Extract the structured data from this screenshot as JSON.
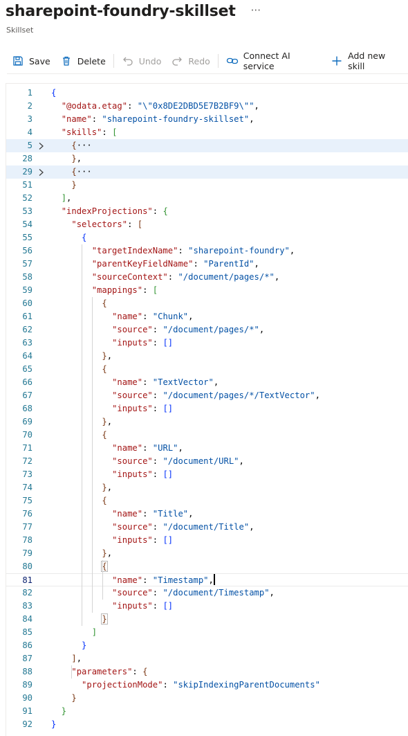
{
  "header": {
    "title": "sharepoint-foundry-skillset",
    "subtitle": "Skillset",
    "more": "···"
  },
  "toolbar": {
    "save": "Save",
    "delete": "Delete",
    "undo": "Undo",
    "redo": "Redo",
    "connect": "Connect AI service",
    "add_skill": "Add new skill"
  },
  "editor": {
    "lines": [
      {
        "n": "1",
        "t": [
          [
            "{",
            "b1"
          ]
        ]
      },
      {
        "n": "2",
        "t": [
          [
            "  "
          ],
          [
            "\"@odata.etag\"",
            "k"
          ],
          [
            ": ",
            "p"
          ],
          [
            "\"\\\"0x8DE2DBD5E7B2BF9\\\"\"",
            "s"
          ],
          [
            ",",
            "p"
          ]
        ]
      },
      {
        "n": "3",
        "t": [
          [
            "  "
          ],
          [
            "\"name\"",
            "k"
          ],
          [
            ": ",
            "p"
          ],
          [
            "\"sharepoint-foundry-skillset\"",
            "s"
          ],
          [
            ",",
            "p"
          ]
        ]
      },
      {
        "n": "4",
        "t": [
          [
            "  "
          ],
          [
            "\"skills\"",
            "k"
          ],
          [
            ": ",
            "p"
          ],
          [
            "[",
            "b2"
          ]
        ]
      },
      {
        "n": "5",
        "t": [
          [
            "    "
          ],
          [
            "{",
            "b3"
          ],
          [
            "···",
            "p"
          ]
        ],
        "fold": true,
        "hl": true
      },
      {
        "n": "28",
        "t": [
          [
            "    "
          ],
          [
            "}",
            "b3"
          ],
          [
            ",",
            "p"
          ]
        ]
      },
      {
        "n": "29",
        "t": [
          [
            "    "
          ],
          [
            "{",
            "b3"
          ],
          [
            "···",
            "p"
          ]
        ],
        "fold": true,
        "hl": true
      },
      {
        "n": "51",
        "t": [
          [
            "    "
          ],
          [
            "}",
            "b3"
          ]
        ]
      },
      {
        "n": "52",
        "t": [
          [
            "  "
          ],
          [
            "]",
            "b2"
          ],
          [
            ",",
            "p"
          ]
        ]
      },
      {
        "n": "53",
        "t": [
          [
            "  "
          ],
          [
            "\"indexProjections\"",
            "k"
          ],
          [
            ": ",
            "p"
          ],
          [
            "{",
            "b2"
          ]
        ]
      },
      {
        "n": "54",
        "t": [
          [
            "    "
          ],
          [
            "\"selectors\"",
            "k"
          ],
          [
            ": ",
            "p"
          ],
          [
            "[",
            "b3"
          ]
        ]
      },
      {
        "n": "55",
        "t": [
          [
            "      "
          ],
          [
            "{",
            "b1"
          ]
        ]
      },
      {
        "n": "56",
        "t": [
          [
            "        "
          ],
          [
            "\"targetIndexName\"",
            "k"
          ],
          [
            ": ",
            "p"
          ],
          [
            "\"sharepoint-foundry\"",
            "s"
          ],
          [
            ",",
            "p"
          ]
        ]
      },
      {
        "n": "57",
        "t": [
          [
            "        "
          ],
          [
            "\"parentKeyFieldName\"",
            "k"
          ],
          [
            ": ",
            "p"
          ],
          [
            "\"ParentId\"",
            "s"
          ],
          [
            ",",
            "p"
          ]
        ]
      },
      {
        "n": "58",
        "t": [
          [
            "        "
          ],
          [
            "\"sourceContext\"",
            "k"
          ],
          [
            ": ",
            "p"
          ],
          [
            "\"/document/pages/*\"",
            "s"
          ],
          [
            ",",
            "p"
          ]
        ]
      },
      {
        "n": "59",
        "t": [
          [
            "        "
          ],
          [
            "\"mappings\"",
            "k"
          ],
          [
            ": ",
            "p"
          ],
          [
            "[",
            "b2"
          ]
        ]
      },
      {
        "n": "60",
        "t": [
          [
            "          "
          ],
          [
            "{",
            "b3"
          ]
        ]
      },
      {
        "n": "61",
        "t": [
          [
            "            "
          ],
          [
            "\"name\"",
            "k"
          ],
          [
            ": ",
            "p"
          ],
          [
            "\"Chunk\"",
            "s"
          ],
          [
            ",",
            "p"
          ]
        ]
      },
      {
        "n": "62",
        "t": [
          [
            "            "
          ],
          [
            "\"source\"",
            "k"
          ],
          [
            ": ",
            "p"
          ],
          [
            "\"/document/pages/*\"",
            "s"
          ],
          [
            ",",
            "p"
          ]
        ]
      },
      {
        "n": "63",
        "t": [
          [
            "            "
          ],
          [
            "\"inputs\"",
            "k"
          ],
          [
            ": ",
            "p"
          ],
          [
            "[]",
            "b1"
          ]
        ]
      },
      {
        "n": "64",
        "t": [
          [
            "          "
          ],
          [
            "}",
            "b3"
          ],
          [
            ",",
            "p"
          ]
        ]
      },
      {
        "n": "65",
        "t": [
          [
            "          "
          ],
          [
            "{",
            "b3"
          ]
        ]
      },
      {
        "n": "66",
        "t": [
          [
            "            "
          ],
          [
            "\"name\"",
            "k"
          ],
          [
            ": ",
            "p"
          ],
          [
            "\"TextVector\"",
            "s"
          ],
          [
            ",",
            "p"
          ]
        ]
      },
      {
        "n": "67",
        "t": [
          [
            "            "
          ],
          [
            "\"source\"",
            "k"
          ],
          [
            ": ",
            "p"
          ],
          [
            "\"/document/pages/*/TextVector\"",
            "s"
          ],
          [
            ",",
            "p"
          ]
        ]
      },
      {
        "n": "68",
        "t": [
          [
            "            "
          ],
          [
            "\"inputs\"",
            "k"
          ],
          [
            ": ",
            "p"
          ],
          [
            "[]",
            "b1"
          ]
        ]
      },
      {
        "n": "69",
        "t": [
          [
            "          "
          ],
          [
            "}",
            "b3"
          ],
          [
            ",",
            "p"
          ]
        ]
      },
      {
        "n": "70",
        "t": [
          [
            "          "
          ],
          [
            "{",
            "b3"
          ]
        ]
      },
      {
        "n": "71",
        "t": [
          [
            "            "
          ],
          [
            "\"name\"",
            "k"
          ],
          [
            ": ",
            "p"
          ],
          [
            "\"URL\"",
            "s"
          ],
          [
            ",",
            "p"
          ]
        ]
      },
      {
        "n": "72",
        "t": [
          [
            "            "
          ],
          [
            "\"source\"",
            "k"
          ],
          [
            ": ",
            "p"
          ],
          [
            "\"/document/URL\"",
            "s"
          ],
          [
            ",",
            "p"
          ]
        ]
      },
      {
        "n": "73",
        "t": [
          [
            "            "
          ],
          [
            "\"inputs\"",
            "k"
          ],
          [
            ": ",
            "p"
          ],
          [
            "[]",
            "b1"
          ]
        ]
      },
      {
        "n": "74",
        "t": [
          [
            "          "
          ],
          [
            "}",
            "b3"
          ],
          [
            ",",
            "p"
          ]
        ]
      },
      {
        "n": "75",
        "t": [
          [
            "          "
          ],
          [
            "{",
            "b3"
          ]
        ]
      },
      {
        "n": "76",
        "t": [
          [
            "            "
          ],
          [
            "\"name\"",
            "k"
          ],
          [
            ": ",
            "p"
          ],
          [
            "\"Title\"",
            "s"
          ],
          [
            ",",
            "p"
          ]
        ]
      },
      {
        "n": "77",
        "t": [
          [
            "            "
          ],
          [
            "\"source\"",
            "k"
          ],
          [
            ": ",
            "p"
          ],
          [
            "\"/document/Title\"",
            "s"
          ],
          [
            ",",
            "p"
          ]
        ]
      },
      {
        "n": "78",
        "t": [
          [
            "            "
          ],
          [
            "\"inputs\"",
            "k"
          ],
          [
            ": ",
            "p"
          ],
          [
            "[]",
            "b1"
          ]
        ]
      },
      {
        "n": "79",
        "t": [
          [
            "          "
          ],
          [
            "}",
            "b3"
          ],
          [
            ",",
            "p"
          ]
        ]
      },
      {
        "n": "80",
        "t": [
          [
            "          "
          ],
          [
            "{",
            "b3 brk"
          ]
        ]
      },
      {
        "n": "81",
        "t": [
          [
            "            "
          ],
          [
            "\"name\"",
            "k"
          ],
          [
            ": ",
            "p"
          ],
          [
            "\"Timestamp\"",
            "s"
          ],
          [
            ",",
            "p"
          ],
          [
            "|",
            "caret"
          ]
        ],
        "cur": true,
        "active": true
      },
      {
        "n": "82",
        "t": [
          [
            "            "
          ],
          [
            "\"source\"",
            "k"
          ],
          [
            ": ",
            "p"
          ],
          [
            "\"/document/Timestamp\"",
            "s"
          ],
          [
            ",",
            "p"
          ]
        ]
      },
      {
        "n": "83",
        "t": [
          [
            "            "
          ],
          [
            "\"inputs\"",
            "k"
          ],
          [
            ": ",
            "p"
          ],
          [
            "[]",
            "b1"
          ]
        ]
      },
      {
        "n": "84",
        "t": [
          [
            "          "
          ],
          [
            "}",
            "b3 brk"
          ]
        ]
      },
      {
        "n": "85",
        "t": [
          [
            "        "
          ],
          [
            "]",
            "b2"
          ]
        ]
      },
      {
        "n": "86",
        "t": [
          [
            "      "
          ],
          [
            "}",
            "b1"
          ]
        ]
      },
      {
        "n": "87",
        "t": [
          [
            "    "
          ],
          [
            "]",
            "b3"
          ],
          [
            ",",
            "p"
          ]
        ]
      },
      {
        "n": "88",
        "t": [
          [
            "    "
          ],
          [
            "\"parameters\"",
            "k"
          ],
          [
            ": ",
            "p"
          ],
          [
            "{",
            "b3"
          ]
        ]
      },
      {
        "n": "89",
        "t": [
          [
            "      "
          ],
          [
            "\"projectionMode\"",
            "k"
          ],
          [
            ": ",
            "p"
          ],
          [
            "\"skipIndexingParentDocuments\"",
            "s"
          ]
        ]
      },
      {
        "n": "90",
        "t": [
          [
            "    "
          ],
          [
            "}",
            "b3"
          ]
        ]
      },
      {
        "n": "91",
        "t": [
          [
            "  "
          ],
          [
            "}",
            "b2"
          ]
        ]
      },
      {
        "n": "92",
        "t": [
          [
            "}",
            "b1"
          ]
        ]
      }
    ]
  }
}
